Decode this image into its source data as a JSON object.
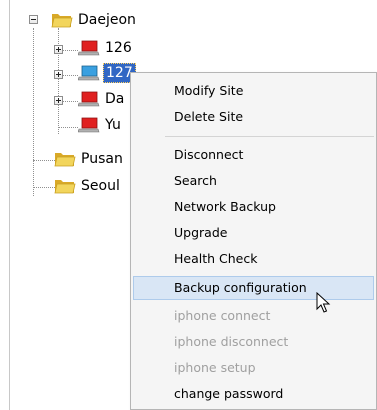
{
  "tree": {
    "root": {
      "label": "Daejeon",
      "icon": "folder-open-icon"
    },
    "children": [
      {
        "label": "126",
        "icon": "computer-red-icon",
        "selected": false
      },
      {
        "label": "127",
        "icon": "computer-blue-icon",
        "selected": true
      },
      {
        "label": "Da",
        "icon": "computer-red-icon",
        "selected": false
      },
      {
        "label": "Yu",
        "icon": "computer-red-icon",
        "selected": false
      }
    ],
    "siblings": [
      {
        "label": "Pusan",
        "icon": "folder-open-icon"
      },
      {
        "label": "Seoul",
        "icon": "folder-open-icon"
      }
    ]
  },
  "context_menu": {
    "groups": [
      [
        "Modify Site",
        "Delete Site"
      ],
      [
        "Disconnect",
        "Search",
        "Network Backup",
        "Upgrade",
        "Health Check",
        "Backup configuration",
        "iphone connect",
        "iphone disconnect",
        "iphone setup",
        "change password"
      ]
    ],
    "hovered": "Backup configuration",
    "disabled": [
      "iphone connect",
      "iphone disconnect",
      "iphone setup"
    ]
  },
  "colors": {
    "selection": "#3167c4",
    "menu_hover": "#d9e6f5",
    "disabled_text": "#a0a0a0",
    "folder": "#e8c64a",
    "computer_red": "#e02020",
    "computer_blue": "#3aa0e0"
  }
}
